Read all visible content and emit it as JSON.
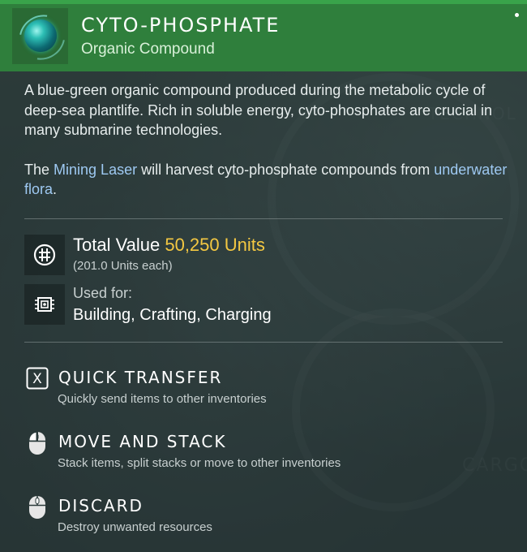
{
  "item": {
    "name": "CYTO-PHOSPHATE",
    "category": "Organic Compound",
    "icon": "cyto-phosphate-orb-icon"
  },
  "description": {
    "paragraph1": "A blue-green organic compound produced during the metabolic cycle of deep-sea plantlife. Rich in soluble energy, cyto-phosphates are crucial in many submarine technologies.",
    "paragraph2_prefix": "The ",
    "paragraph2_link1": "Mining Laser",
    "paragraph2_middle": " will harvest cyto-phosphate compounds from ",
    "paragraph2_link2": "underwater flora",
    "paragraph2_suffix": "."
  },
  "value": {
    "label": "Total Value",
    "amount": "50,250 Units",
    "each": "(201.0 Units each)",
    "icon": "units-icon"
  },
  "usage": {
    "label": "Used for:",
    "value": "Building, Crafting, Charging",
    "icon": "chip-icon"
  },
  "actions": [
    {
      "key": "X",
      "title": "QUICK TRANSFER",
      "desc": "Quickly send items to other inventories",
      "icon": "x-key-icon"
    },
    {
      "title": "MOVE AND STACK",
      "desc": "Stack items, split stacks or move to other inventories",
      "icon": "mouse-left-click-icon"
    },
    {
      "title": "DISCARD",
      "desc": "Destroy unwanted resources",
      "icon": "mouse-middle-click-icon"
    }
  ],
  "colors": {
    "header": "#2f7f3c",
    "accent_value": "#f4c842",
    "link": "#9ec9f2"
  }
}
